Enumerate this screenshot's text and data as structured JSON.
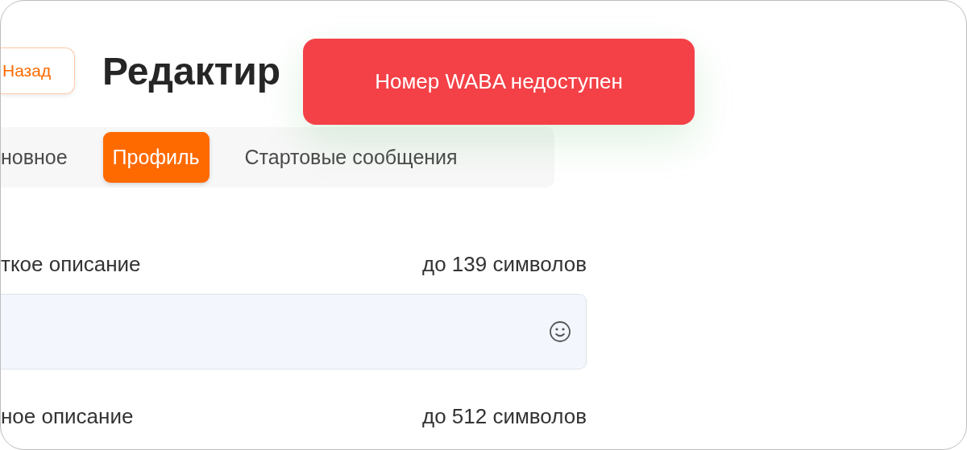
{
  "header": {
    "back_button": "Назад",
    "title": "Редактир"
  },
  "toast": {
    "kind": "error",
    "message": "Номер WABA недоступен"
  },
  "tabs": [
    {
      "label": "новное",
      "selected": false
    },
    {
      "label": "Профиль",
      "selected": true
    },
    {
      "label": "Стартовые сообщения",
      "selected": false
    }
  ],
  "fields": [
    {
      "label": "ткое описание",
      "limit": "до 139 символов",
      "kind": "input"
    },
    {
      "label": "ное описание",
      "limit": "до 512 символов",
      "kind": "label"
    }
  ]
}
